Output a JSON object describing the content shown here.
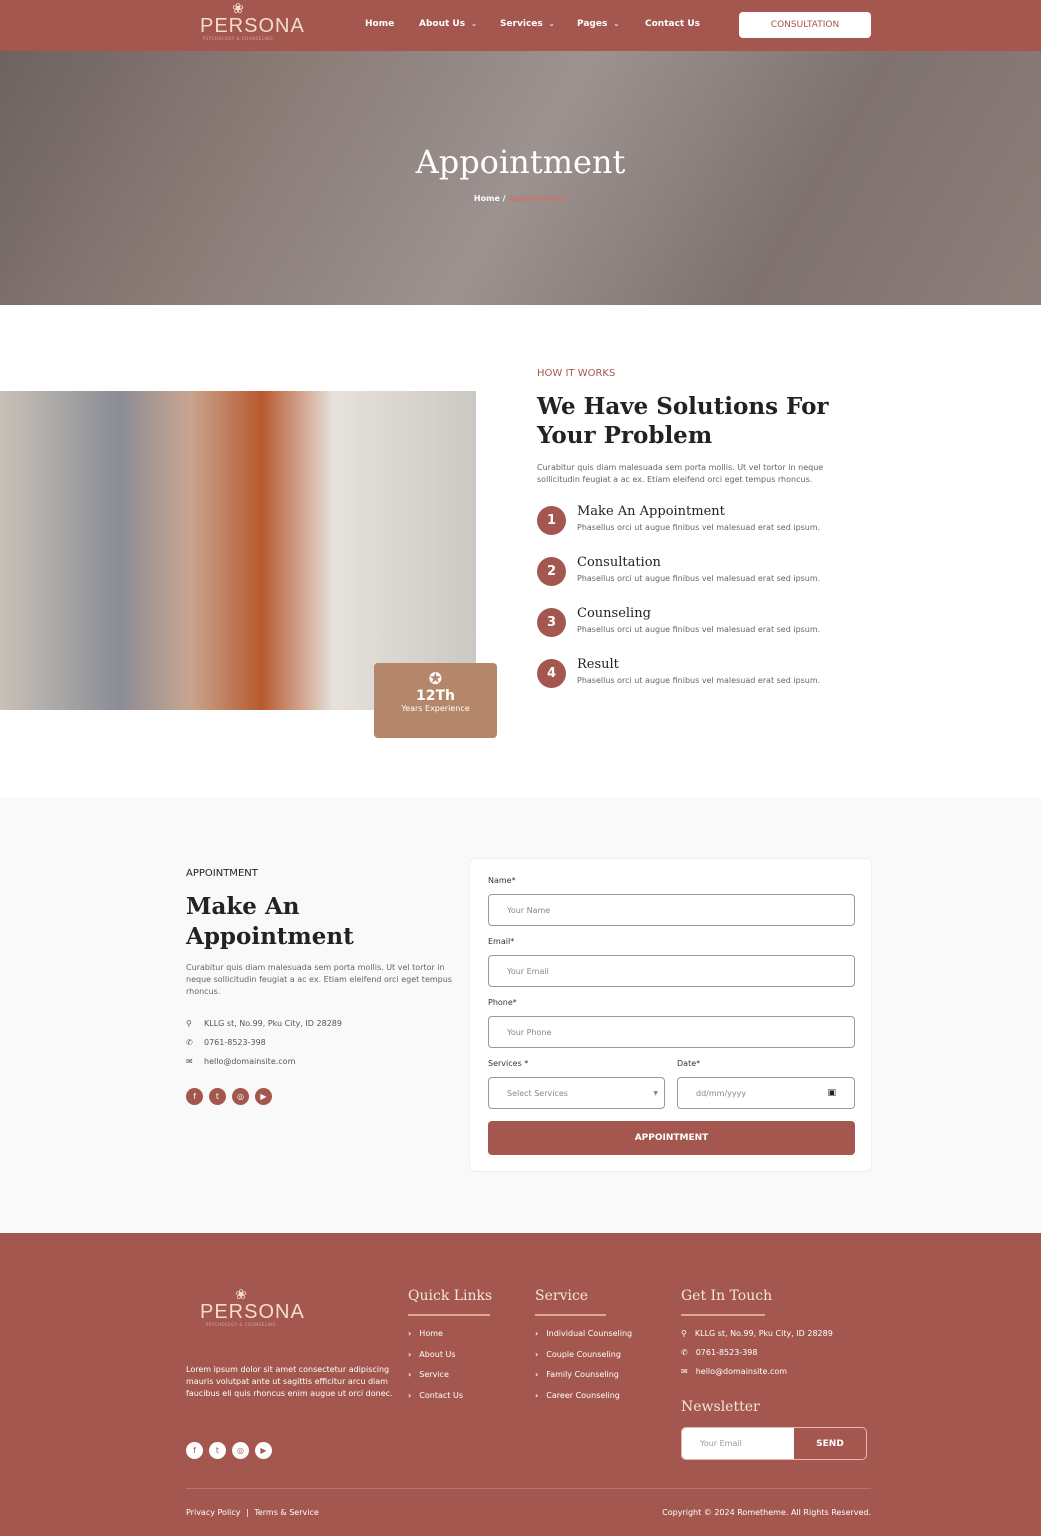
{
  "brand": {
    "name": "PERSONA",
    "tagline": "PSYCHOLOGY & COUNSELING"
  },
  "nav": {
    "items": [
      "Home",
      "About Us",
      "Services",
      "Pages",
      "Contact Us"
    ],
    "cta": "CONSULTATION"
  },
  "hero": {
    "title": "Appointment",
    "crumb_home": "Home /",
    "crumb_current": "Appointment"
  },
  "how": {
    "eyebrow": "HOW IT WORKS",
    "title_l1": "We Have Solutions For",
    "title_l2": "Your Problem",
    "desc": "Curabitur quis diam malesuada sem porta mollis. Ut vel tortor in neque sollicitudin feugiat a ac ex. Etiam eleifend orci eget tempus rhoncus.",
    "steps": [
      {
        "num": "1",
        "title": "Make An Appointment",
        "desc": "Phasellus orci ut augue finibus vel malesuad erat sed ipsum."
      },
      {
        "num": "2",
        "title": "Consultation",
        "desc": "Phasellus orci ut augue finibus vel malesuad erat sed ipsum."
      },
      {
        "num": "3",
        "title": "Counseling",
        "desc": "Phasellus orci ut augue finibus vel malesuad erat sed ipsum."
      },
      {
        "num": "4",
        "title": "Result",
        "desc": "Phasellus orci ut augue finibus vel malesuad erat sed ipsum."
      }
    ],
    "badge": {
      "value": "12Th",
      "label": "Years Experience"
    }
  },
  "appointment": {
    "eyebrow": "APPOINTMENT",
    "title_l1": "Make An",
    "title_l2": "Appointment",
    "desc": "Curabitur quis diam malesuada sem porta mollis. Ut vel tortor in neque sollicitudin feugiat a ac ex. Etiam eleifend orci eget tempus rhoncus.",
    "address": "KLLG st, No.99, Pku City, ID 28289",
    "phone": "0761-8523-398",
    "email": "hello@domainsite.com",
    "form": {
      "name_label": "Name*",
      "name_ph": "Your Name",
      "email_label": "Email*",
      "email_ph": "Your Email",
      "phone_label": "Phone*",
      "phone_ph": "Your Phone",
      "services_label": "Services *",
      "services_value": "Select Services",
      "date_label": "Date*",
      "date_ph": "dd/mm/yyyy",
      "submit": "APPOINTMENT"
    }
  },
  "footer": {
    "about": "Lorem ipsum dolor sit amet consectetur adipiscing mauris volutpat ante ut sagittis efficitur arcu diam faucibus eli quis rhoncus enim augue ut orci donec.",
    "quick_title": "Quick Links",
    "quick": [
      "Home",
      "About Us",
      "Service",
      "Contact Us"
    ],
    "service_title": "Service",
    "services": [
      "Individual Counseling",
      "Couple Counseling",
      "Family Counseling",
      "Career Counseling"
    ],
    "touch_title": "Get In Touch",
    "address": "KLLG st, No.99, Pku City, ID 28289",
    "phone": "0761-8523-398",
    "email": "hello@domainsite.com",
    "newsletter_title": "Newsletter",
    "newsletter_ph": "Your Email",
    "send": "SEND",
    "privacy": "Privacy Policy",
    "terms": "Terms & Service",
    "copyright": "Copyright © 2024 Rometheme. All Rights Reserved."
  },
  "colors": {
    "primary": "#a3574e",
    "badge": "#b4866a"
  }
}
